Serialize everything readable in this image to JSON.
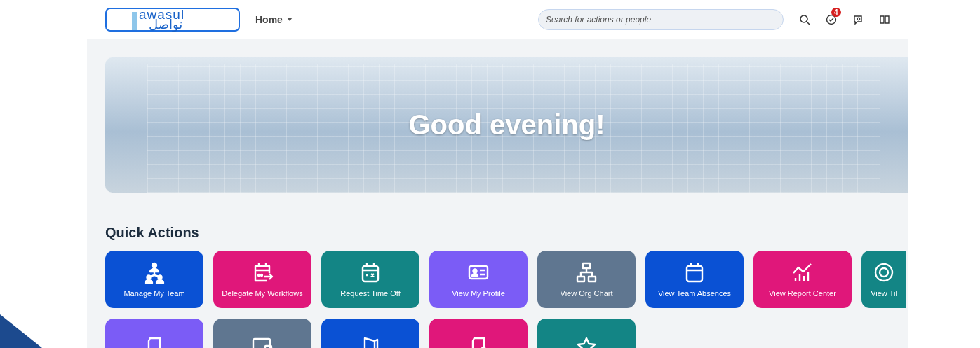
{
  "header": {
    "logo": {
      "latin": "awasul",
      "arabic": "تواصل"
    },
    "nav": {
      "label": "Home"
    },
    "search": {
      "placeholder": "Search for actions or people"
    },
    "notifications": {
      "count": "4"
    }
  },
  "banner": {
    "greeting": "Good evening!"
  },
  "quick_actions": {
    "title": "Quick Actions",
    "tiles": [
      {
        "label": "Manage My Team",
        "color": "#0a51d4"
      },
      {
        "label": "Delegate My Workflows",
        "color": "#e0177a"
      },
      {
        "label": "Request Time Off",
        "color": "#138585"
      },
      {
        "label": "View My Profile",
        "color": "#7b5cf6"
      },
      {
        "label": "View Org Chart",
        "color": "#5f7690"
      },
      {
        "label": "View Team Absences",
        "color": "#0a51d4"
      },
      {
        "label": "View Report Center",
        "color": "#e0177a"
      },
      {
        "label": "View Til",
        "color": "#138585"
      },
      {
        "color": "#7b5cf6"
      },
      {
        "color": "#5f7690"
      },
      {
        "color": "#0a51d4"
      },
      {
        "color": "#e0177a"
      },
      {
        "color": "#138585"
      }
    ]
  }
}
